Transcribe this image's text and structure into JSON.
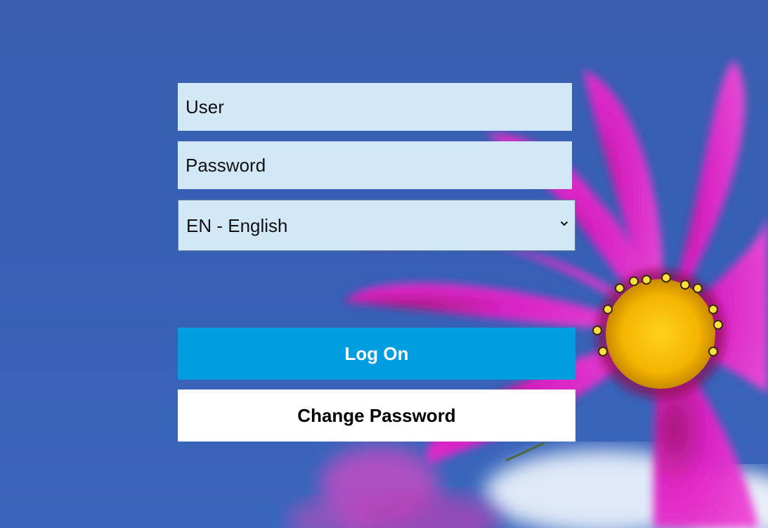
{
  "login": {
    "user_placeholder": "User",
    "password_placeholder": "Password",
    "language_selected": "EN - English",
    "log_on_label": "Log On",
    "change_password_label": "Change Password"
  },
  "colors": {
    "field_background": "#d2e8f7",
    "primary_button": "#009ee0",
    "secondary_button": "#ffffff",
    "sky": "#3560b4"
  },
  "icons": {
    "select_arrow": "chevron-down-icon"
  }
}
